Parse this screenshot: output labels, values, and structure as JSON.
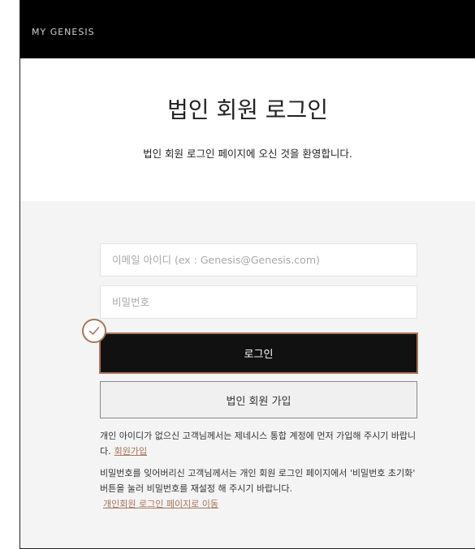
{
  "header": {
    "brand": "MY GENESIS"
  },
  "hero": {
    "title": "법인 회원 로그인",
    "subtitle": "법인 회원 로그인 페이지에 오신 것을 환영합니다."
  },
  "form": {
    "email_placeholder": "이메일 아이디 (ex : Genesis@Genesis.com)",
    "password_placeholder": "비밀번호",
    "login_label": "로그인",
    "signup_label": "법인 회원 가입"
  },
  "notes": {
    "note1_text": "개인 아이디가 없으신 고객님께서는 제네시스 통합 계정에 먼저 가입해 주시기 바랍니다.",
    "note1_link": "회원가입",
    "note2_text": "비밀번호를 잊어버리신 고객님께서는 개인 회원 로그인 페이지에서 '비밀번호 초기화' 버튼을 눌러 비밀번호를 재설정 해 주시기 바랍니다.",
    "note2_link": "개인회원 로그인 페이지로 이동"
  },
  "colors": {
    "accent": "#a9745a",
    "header_bg": "#000000",
    "form_bg": "#f4f4f4"
  },
  "icons": {
    "selection_marker": "check-circle-icon"
  }
}
